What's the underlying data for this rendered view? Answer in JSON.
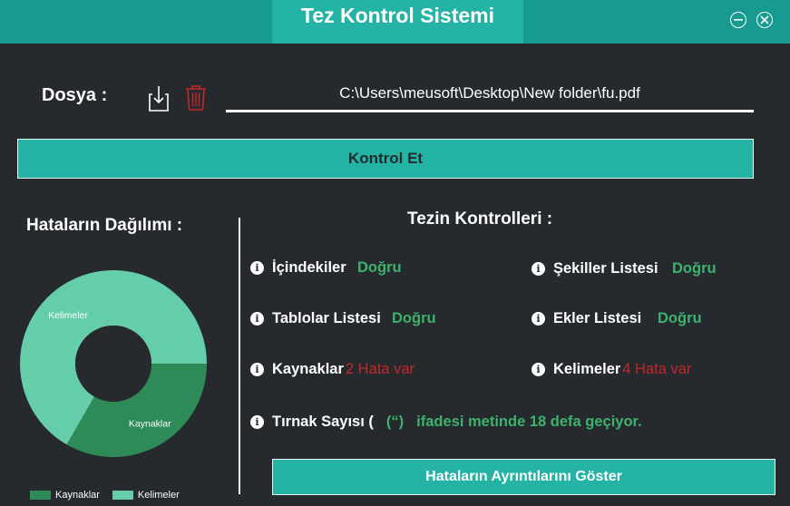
{
  "window": {
    "title": "Tez Kontrol Sistemi",
    "controls": [
      "minimize-icon",
      "close-icon"
    ]
  },
  "file": {
    "label": "Dosya :",
    "path": "C:\\Users\\meusoft\\Desktop\\New folder\\fu.pdf",
    "icons": [
      "download-icon",
      "trash-icon"
    ]
  },
  "kontrol_button": "Kontrol Et",
  "distribution": {
    "title": "Hataların Dağılımı :",
    "colors": {
      "kaynaklar": "#2e8b57",
      "kelimeler": "#66cdaa"
    }
  },
  "chart_data": {
    "type": "pie",
    "donut": true,
    "categories": [
      "Kaynaklar",
      "Kelimeler"
    ],
    "values": [
      2,
      4
    ],
    "legend": [
      "Kaynaklar",
      "Kelimeler"
    ],
    "legend_position": "bottom"
  },
  "checks": {
    "title": "Tezin Kontrolleri :",
    "items": [
      {
        "label": "İçindekiler",
        "status": "Doğru"
      },
      {
        "label": "Şekiller Listesi",
        "status": "Doğru"
      },
      {
        "label": "Tablolar Listesi",
        "status": "Doğru"
      },
      {
        "label": "Ekler Listesi",
        "status": "Doğru"
      },
      {
        "label": "Kaynaklar",
        "status": "2 Hata var"
      },
      {
        "label": "Kelimeler",
        "status": "4 Hata var"
      }
    ],
    "tirnak": {
      "label": "Tırnak Sayısı (",
      "quote": "(“)",
      "message": "ifadesi metinde 18 defa geçiyor."
    }
  },
  "detail_button": "Hataların Ayrıntılarını Göster",
  "colors": {
    "accent": "#24b3a5",
    "ok": "#3bb36d",
    "error": "#c2292a",
    "background": "#26292d"
  }
}
